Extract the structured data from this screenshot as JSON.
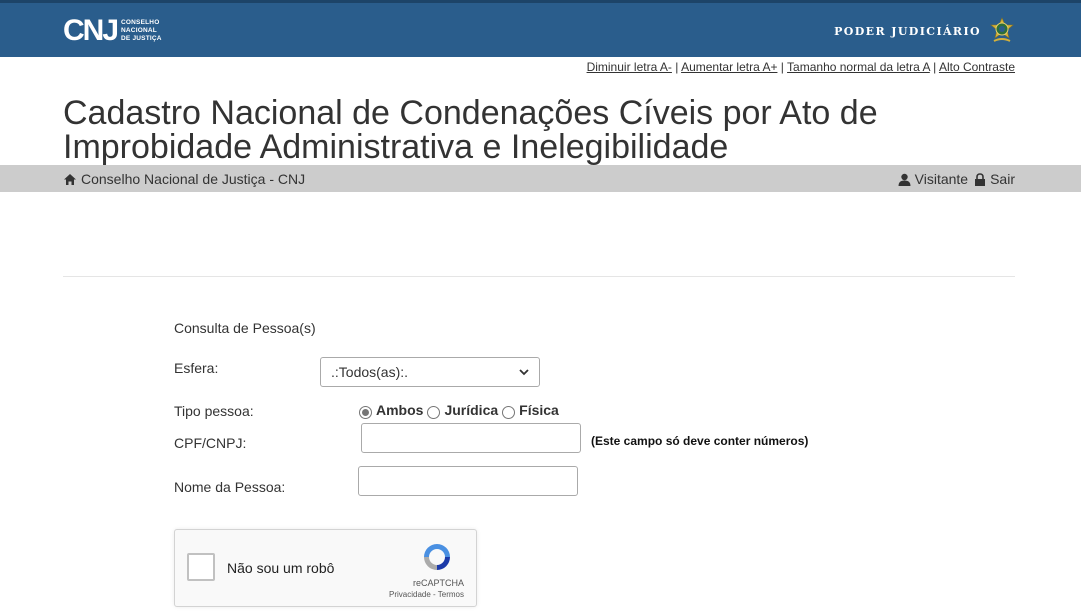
{
  "header": {
    "logo_mark": "CNJ",
    "logo_lines": [
      "CONSELHO",
      "NACIONAL",
      "DE JUSTIÇA"
    ],
    "poder_judiciario": "PODER JUDICIÁRIO"
  },
  "accessibility": {
    "decrease": "Diminuir letra A-",
    "increase": "Aumentar letra A+",
    "normal": "Tamanho normal da letra A",
    "contrast": "Alto Contraste",
    "separator": "|"
  },
  "page_title": "Cadastro Nacional de Condenações Cíveis por Ato de Improbidade Administrativa e Inelegibilidade",
  "breadcrumb": "Conselho Nacional de Justiça - CNJ",
  "user": {
    "name": "Visitante",
    "logout": "Sair"
  },
  "form": {
    "section_title": "Consulta de Pessoa(s)",
    "esfera_label": "Esfera:",
    "esfera_value": ".:Todos(as):.",
    "tipo_label": "Tipo pessoa:",
    "tipo_options": [
      "Ambos",
      "Jurídica",
      "Física"
    ],
    "tipo_selected": "Ambos",
    "cpf_label": "CPF/CNPJ:",
    "cpf_value": "",
    "cpf_hint": "(Este campo só deve conter números)",
    "nome_label": "Nome da Pessoa:",
    "nome_value": ""
  },
  "recaptcha": {
    "label": "Não sou um robô",
    "brand": "reCAPTCHA",
    "links": "Privacidade - Termos"
  },
  "colors": {
    "topbar": "#2a5d8c",
    "greybar": "#cccccc"
  }
}
